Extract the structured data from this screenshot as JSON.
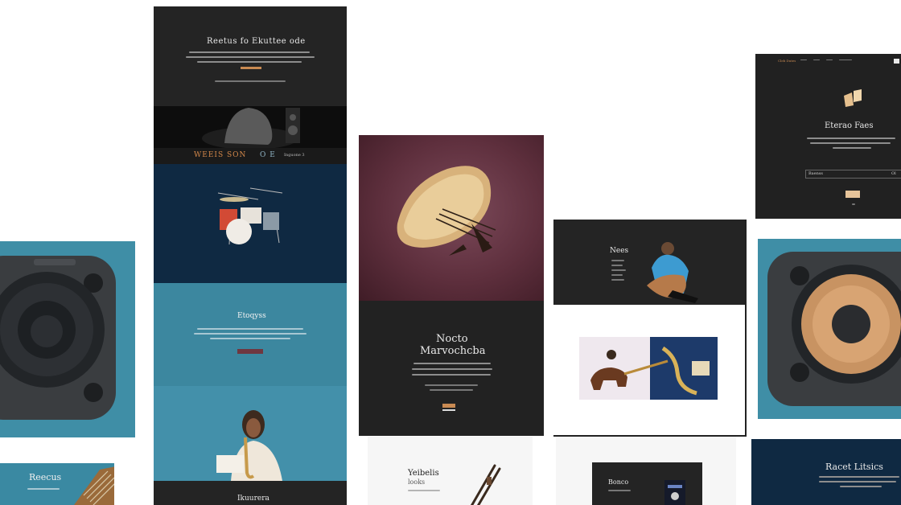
{
  "colors": {
    "accent": "#c98a52",
    "teal": "#3c879f",
    "navy": "#0f2942",
    "dark": "#242424",
    "rose": "#6f3740"
  },
  "left_stack": {
    "top_title": "Reetus fo Ekuttee ode",
    "banner_text": "WEEIS SON ",
    "banner_suffix": "O E",
    "banner_link": "Inguone 3",
    "teal_title": "Etoqyss",
    "bottom_title": "Ikuurera"
  },
  "speaker_left": {
    "caption": "Reecus"
  },
  "center": {
    "title_line1": "Nocto",
    "title_line2": "Marvochcba"
  },
  "mid_right": {
    "dark_title": "Nees"
  },
  "bottom_center": {
    "title": "Yeibelis",
    "subtitle": "looks"
  },
  "bottom_mid": {
    "title": "Bonco"
  },
  "top_right": {
    "logo": "Cleb Dutes",
    "title": "Eterao Faes",
    "field_value": "Baenss",
    "field_suffix": "Ol"
  },
  "bottom_right": {
    "title": "Racet Litsics"
  }
}
